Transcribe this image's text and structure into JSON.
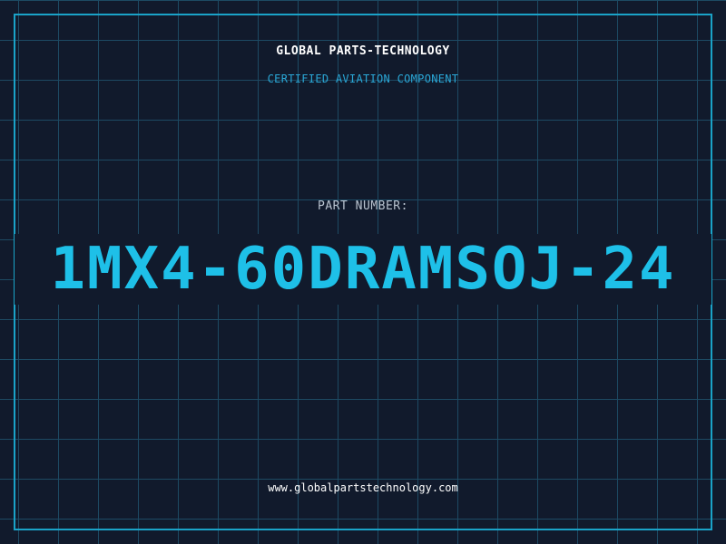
{
  "header": {
    "company": "GLOBAL PARTS-TECHNOLOGY",
    "subtitle": "CERTIFIED AVIATION COMPONENT"
  },
  "part": {
    "label": "PART NUMBER:",
    "number": "1MX4-60DRAMSOJ-24"
  },
  "footer": {
    "website": "www.globalpartstechnology.com"
  },
  "colors": {
    "background": "#111a2c",
    "grid": "#1d4a63",
    "frame": "#1aa3c8",
    "accent": "#1ec0e8",
    "subtitle": "#2aa7d6"
  }
}
